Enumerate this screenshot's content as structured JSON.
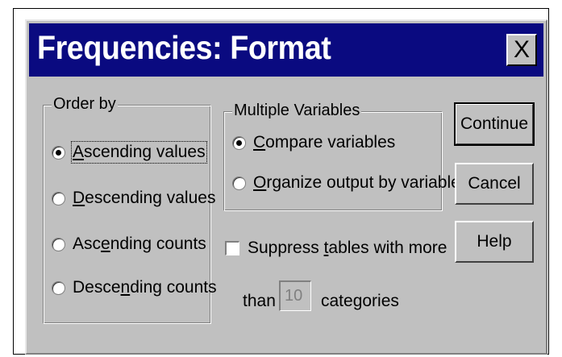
{
  "window": {
    "title": "Frequencies: Format",
    "close_glyph": "X"
  },
  "order_by": {
    "legend": "Order by",
    "options": [
      {
        "pre": "",
        "mnemonic": "A",
        "post": "scending values",
        "checked": true
      },
      {
        "pre": "",
        "mnemonic": "D",
        "post": "escending values",
        "checked": false
      },
      {
        "pre": "Asc",
        "mnemonic": "e",
        "post": "nding counts",
        "checked": false
      },
      {
        "pre": "Desce",
        "mnemonic": "n",
        "post": "ding counts",
        "checked": false
      }
    ]
  },
  "multiple_variables": {
    "legend": "Multiple Variables",
    "options": [
      {
        "pre": "",
        "mnemonic": "C",
        "post": "ompare variables",
        "checked": true
      },
      {
        "pre": "",
        "mnemonic": "O",
        "post": "rganize output by variables",
        "checked": false
      }
    ]
  },
  "suppress": {
    "pre": "Suppress ",
    "mnemonic": "t",
    "post": "ables with more",
    "checked": false,
    "than_label": "than",
    "value": "10",
    "categories_label": "categories"
  },
  "buttons": {
    "continue": "Continue",
    "cancel": "Cancel",
    "help": "Help"
  },
  "colors": {
    "titlebar": "#0a0a80",
    "face": "#c0c0c0"
  }
}
